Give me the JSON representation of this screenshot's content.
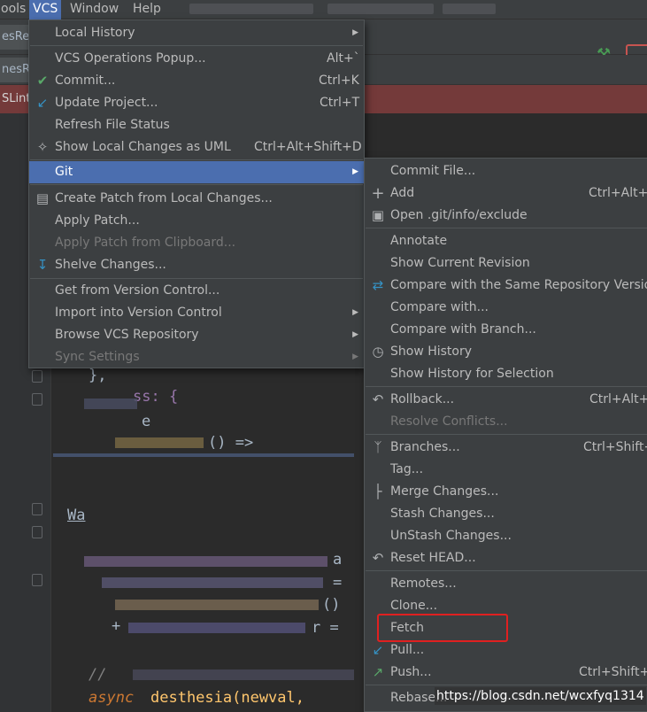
{
  "menubar": {
    "items": [
      "ools",
      "VCS",
      "Window",
      "Help"
    ]
  },
  "tabs": {
    "frag1": "esRe",
    "frag2": "nesRe",
    "frag3": "SLint"
  },
  "code": {
    "line1": "},",
    "line2": "ss: {",
    "line3": "e",
    "line4": "() =>",
    "line5": "Wa",
    "line6": "a",
    "line7": "=",
    "line8": "()",
    "line9": "+",
    "line10": "r =",
    "line11": "//",
    "line12": "async",
    "line13": "desthesia(newval,"
  },
  "vcs_menu": {
    "items": [
      {
        "label": "Local History",
        "underline": "H",
        "submenu": true
      },
      {
        "label": "VCS Operations Popup...",
        "shortcut": "Alt+`"
      },
      {
        "label": "Commit...",
        "shortcut": "Ctrl+K",
        "icon": "check-icon"
      },
      {
        "label": "Update Project...",
        "shortcut": "Ctrl+T",
        "icon": "update-arrow-icon"
      },
      {
        "label": "Refresh File Status"
      },
      {
        "label": "Show Local Changes as UML",
        "shortcut": "Ctrl+Alt+Shift+D",
        "icon": "uml-icon"
      },
      {
        "label": "Git",
        "submenu": true,
        "highlighted": true
      },
      {
        "label": "Create Patch from Local Changes...",
        "icon": "patch-icon"
      },
      {
        "label": "Apply Patch..."
      },
      {
        "label": "Apply Patch from Clipboard...",
        "disabled": true
      },
      {
        "label": "Shelve Changes...",
        "icon": "shelve-icon"
      },
      {
        "label": "Get from Version Control..."
      },
      {
        "label": "Import into Version Control",
        "submenu": true
      },
      {
        "label": "Browse VCS Repository",
        "submenu": true
      },
      {
        "label": "Sync Settings",
        "submenu": true,
        "disabled": true
      }
    ]
  },
  "git_menu": {
    "items": [
      {
        "label": "Commit File..."
      },
      {
        "label": "Add",
        "shortcut": "Ctrl+Alt+A",
        "icon": "plus-icon"
      },
      {
        "label": "Open .git/info/exclude",
        "icon": "open-file-icon"
      },
      {
        "label": "Annotate"
      },
      {
        "label": "Show Current Revision"
      },
      {
        "label": "Compare with the Same Repository Version",
        "icon": "compare-icon"
      },
      {
        "label": "Compare with..."
      },
      {
        "label": "Compare with Branch..."
      },
      {
        "label": "Show History",
        "icon": "clock-icon"
      },
      {
        "label": "Show History for Selection"
      },
      {
        "label": "Rollback...",
        "shortcut": "Ctrl+Alt+Z",
        "icon": "rollback-icon"
      },
      {
        "label": "Resolve Conflicts...",
        "disabled": true
      },
      {
        "label": "Branches...",
        "shortcut": "Ctrl+Shift+`",
        "icon": "branch-icon"
      },
      {
        "label": "Tag..."
      },
      {
        "label": "Merge Changes...",
        "icon": "merge-icon"
      },
      {
        "label": "Stash Changes..."
      },
      {
        "label": "UnStash Changes..."
      },
      {
        "label": "Reset HEAD...",
        "icon": "reset-icon"
      },
      {
        "label": "Remotes..."
      },
      {
        "label": "Clone..."
      },
      {
        "label": "Fetch"
      },
      {
        "label": "Pull...",
        "icon": "pull-arrow-icon"
      },
      {
        "label": "Push...",
        "shortcut": "Ctrl+Shift+K",
        "icon": "push-arrow-icon"
      },
      {
        "label": "Rebase..."
      }
    ]
  },
  "watermark": "https://blog.csdn.net/wcxfyq1314",
  "colors": {
    "menu_bg": "#3c3f41",
    "highlight": "#4b6eaf",
    "annotation_red": "#e02020"
  }
}
